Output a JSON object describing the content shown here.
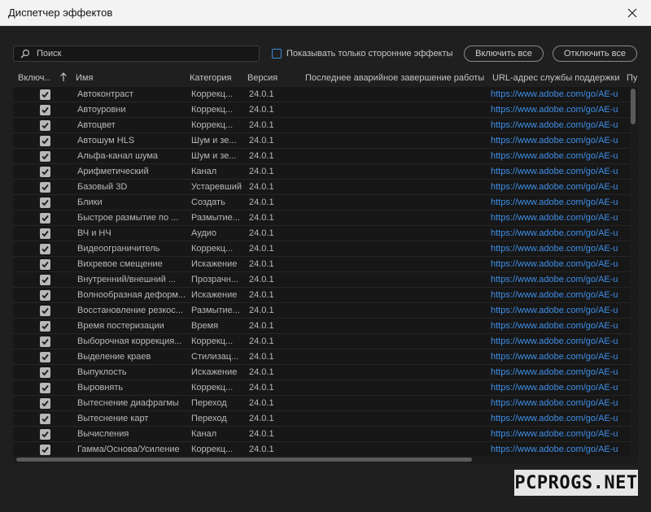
{
  "window": {
    "title": "Диспетчер эффектов"
  },
  "toolbar": {
    "search_placeholder": "Поиск",
    "third_party_label": "Показывать только сторонние эффекты",
    "enable_all": "Включить все",
    "disable_all": "Отключить все"
  },
  "columns": {
    "enabled": "Включ...",
    "name": "Имя",
    "category": "Категория",
    "version": "Версия",
    "last_crash": "Последнее аварийное завершение работы",
    "support_url": "URL-адрес службы поддержки",
    "extra": "Пу"
  },
  "rows": [
    {
      "name": "Автоконтраст",
      "category": "Коррекц...",
      "version": "24.0.1",
      "url": "https://www.adobe.com/go/AE-u",
      "enabled": true
    },
    {
      "name": "Автоуровни",
      "category": "Коррекц...",
      "version": "24.0.1",
      "url": "https://www.adobe.com/go/AE-u",
      "enabled": true
    },
    {
      "name": "Автоцвет",
      "category": "Коррекц...",
      "version": "24.0.1",
      "url": "https://www.adobe.com/go/AE-u",
      "enabled": true
    },
    {
      "name": "Автошум HLS",
      "category": "Шум и зе...",
      "version": "24.0.1",
      "url": "https://www.adobe.com/go/AE-u",
      "enabled": true
    },
    {
      "name": "Альфа-канал шума",
      "category": "Шум и зе...",
      "version": "24.0.1",
      "url": "https://www.adobe.com/go/AE-u",
      "enabled": true
    },
    {
      "name": "Арифметический",
      "category": "Канал",
      "version": "24.0.1",
      "url": "https://www.adobe.com/go/AE-u",
      "enabled": true
    },
    {
      "name": "Базовый 3D",
      "category": "Устаревший",
      "version": "24.0.1",
      "url": "https://www.adobe.com/go/AE-u",
      "enabled": true
    },
    {
      "name": "Блики",
      "category": "Создать",
      "version": "24.0.1",
      "url": "https://www.adobe.com/go/AE-u",
      "enabled": true
    },
    {
      "name": "Быстрое размытие по ...",
      "category": "Размытие...",
      "version": "24.0.1",
      "url": "https://www.adobe.com/go/AE-u",
      "enabled": true
    },
    {
      "name": "ВЧ и НЧ",
      "category": "Аудио",
      "version": "24.0.1",
      "url": "https://www.adobe.com/go/AE-u",
      "enabled": true
    },
    {
      "name": "Видеоограничитель",
      "category": "Коррекц...",
      "version": "24.0.1",
      "url": "https://www.adobe.com/go/AE-u",
      "enabled": true
    },
    {
      "name": "Вихревое смещение",
      "category": "Искажение",
      "version": "24.0.1",
      "url": "https://www.adobe.com/go/AE-u",
      "enabled": true
    },
    {
      "name": "Внутренний/внешний ...",
      "category": "Прозрачн...",
      "version": "24.0.1",
      "url": "https://www.adobe.com/go/AE-u",
      "enabled": true
    },
    {
      "name": "Волнообразная деформ...",
      "category": "Искажение",
      "version": "24.0.1",
      "url": "https://www.adobe.com/go/AE-u",
      "enabled": true
    },
    {
      "name": "Восстановление резкос...",
      "category": "Размытие...",
      "version": "24.0.1",
      "url": "https://www.adobe.com/go/AE-u",
      "enabled": true
    },
    {
      "name": "Время постеризации",
      "category": "Время",
      "version": "24.0.1",
      "url": "https://www.adobe.com/go/AE-u",
      "enabled": true
    },
    {
      "name": "Выборочная коррекция...",
      "category": "Коррекц...",
      "version": "24.0.1",
      "url": "https://www.adobe.com/go/AE-u",
      "enabled": true
    },
    {
      "name": "Выделение краев",
      "category": "Стилизац...",
      "version": "24.0.1",
      "url": "https://www.adobe.com/go/AE-u",
      "enabled": true
    },
    {
      "name": "Выпуклость",
      "category": "Искажение",
      "version": "24.0.1",
      "url": "https://www.adobe.com/go/AE-u",
      "enabled": true
    },
    {
      "name": "Выровнять",
      "category": "Коррекц...",
      "version": "24.0.1",
      "url": "https://www.adobe.com/go/AE-u",
      "enabled": true
    },
    {
      "name": "Вытеснение диафрагмы",
      "category": "Переход",
      "version": "24.0.1",
      "url": "https://www.adobe.com/go/AE-u",
      "enabled": true
    },
    {
      "name": "Вытеснение карт",
      "category": "Переход",
      "version": "24.0.1",
      "url": "https://www.adobe.com/go/AE-u",
      "enabled": true
    },
    {
      "name": "Вычисления",
      "category": "Канал",
      "version": "24.0.1",
      "url": "https://www.adobe.com/go/AE-u",
      "enabled": true
    },
    {
      "name": "Гамма/Основа/Усиление",
      "category": "Коррекц...",
      "version": "24.0.1",
      "url": "https://www.adobe.com/go/AE-u",
      "enabled": true
    }
  ],
  "watermark": "PCPROGS.NET",
  "colors": {
    "accent": "#3d8bd8",
    "link": "#3e8ee6",
    "background": "#1f1f1f"
  }
}
